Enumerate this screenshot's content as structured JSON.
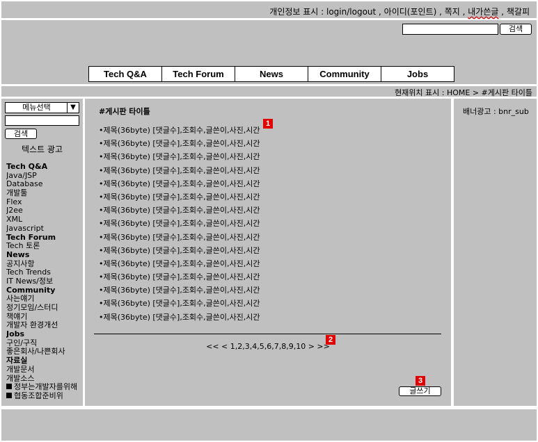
{
  "topbar": {
    "info_prefix": "개인정보 표시 : login/logout , 아이디(포인트) , 쪽지 , ",
    "my_posts": "내가쓴글",
    "separator": " , ",
    "bookmark": "책갈피"
  },
  "header": {
    "search_value": "",
    "search_button": "검색"
  },
  "nav": [
    "Tech Q&A",
    "Tech Forum",
    "News",
    "Community",
    "Jobs"
  ],
  "location": "현재위치 표시 : HOME > #게시판 타이틀",
  "left": {
    "menu_select": "메뉴선택",
    "search_value": "",
    "search_button": "검색",
    "text_ad": "텍스트 광고",
    "menu": [
      {
        "label": "Tech Q&A",
        "cat": true
      },
      {
        "label": "Java/JSP"
      },
      {
        "label": "Database"
      },
      {
        "label": "개발툴"
      },
      {
        "label": "Flex"
      },
      {
        "label": "J2ee"
      },
      {
        "label": "XML"
      },
      {
        "label": "Javascript"
      },
      {
        "label": "Tech Forum",
        "cat": true
      },
      {
        "label": "Tech 토론"
      },
      {
        "label": "News",
        "cat": true
      },
      {
        "label": "공지사항"
      },
      {
        "label": "Tech Trends"
      },
      {
        "label": "IT News/정보"
      },
      {
        "label": "Community",
        "cat": true
      },
      {
        "label": "사는얘기"
      },
      {
        "label": "정기모임/스터디"
      },
      {
        "label": "책얘기"
      },
      {
        "label": "개발자 환경개선"
      },
      {
        "label": "Jobs",
        "cat": true
      },
      {
        "label": "구인/구직"
      },
      {
        "label": "좋은회사/나쁜회사"
      },
      {
        "label": "자료실",
        "cat": true
      },
      {
        "label": "개발문서"
      },
      {
        "label": "개발소스"
      },
      {
        "label": "정부는개발자를위해",
        "box": true
      },
      {
        "label": "협동조합준비위",
        "box": true
      }
    ]
  },
  "board": {
    "title": "#게시판 타이틀",
    "post_text": "•제목(36byte) [댓글수],조회수,글쓴이,사진,시간",
    "posts": [
      1,
      2,
      3,
      4,
      5,
      6,
      7,
      8,
      9,
      10,
      11,
      12,
      13,
      14,
      15
    ],
    "pager": "<< < 1,2,3,4,5,6,7,8,9,10 > >>",
    "write_button": "글쓰기"
  },
  "badges": [
    "1",
    "2",
    "3"
  ],
  "right": {
    "banner": "배너광고 : bnr_sub"
  },
  "colors": {
    "panel": "#c0c0c0",
    "badge": "#e00000"
  }
}
